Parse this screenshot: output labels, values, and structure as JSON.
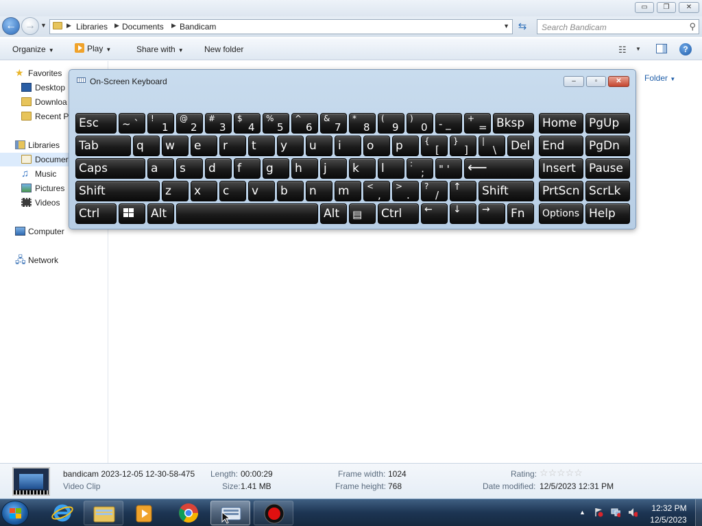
{
  "window": {
    "minimize": "▭",
    "maximize": "❐",
    "close": "✕"
  },
  "address": {
    "crumbs": [
      "Libraries",
      "Documents",
      "Bandicam"
    ],
    "search_placeholder": "Search Bandicam"
  },
  "toolbar": {
    "organize": "Organize",
    "play": "Play",
    "share_with": "Share with",
    "new_folder": "New folder"
  },
  "nav": {
    "favorites": "Favorites",
    "desktop": "Desktop",
    "downloads": "Downloa",
    "recent_places": "Recent Pl",
    "libraries": "Libraries",
    "documents": "Documer",
    "music": "Music",
    "pictures": "Pictures",
    "videos": "Videos",
    "computer": "Computer",
    "network": "Network"
  },
  "content": {
    "arrange_by": "Folder"
  },
  "osk": {
    "title": "On-Screen Keyboard",
    "keys": {
      "esc": "Esc",
      "tilde": "~ `",
      "d1_s": "!",
      "d1": "1",
      "d2_s": "@",
      "d2": "2",
      "d3_s": "#",
      "d3": "3",
      "d4_s": "$",
      "d4": "4",
      "d5_s": "%",
      "d5": "5",
      "d6_s": "^",
      "d6": "6",
      "d7_s": "&",
      "d7": "7",
      "d8_s": "*",
      "d8": "8",
      "d9_s": "(",
      "d9": "9",
      "d0_s": ")",
      "d0": "0",
      "minus": "- _",
      "plus_s": "+",
      "equals": "=",
      "bksp": "Bksp",
      "home": "Home",
      "pgup": "PgUp",
      "tab": "Tab",
      "q": "q",
      "w": "w",
      "e": "e",
      "r": "r",
      "t": "t",
      "y": "y",
      "u": "u",
      "i": "i",
      "o": "o",
      "p": "p",
      "lbr_s": "{",
      "lbr": "[",
      "rbr_s": "}",
      "rbr": "]",
      "bsl_s": "|",
      "bsl": "\\",
      "del": "Del",
      "end": "End",
      "pgdn": "PgDn",
      "caps": "Caps",
      "a": "a",
      "s": "s",
      "d": "d",
      "f": "f",
      "g": "g",
      "h": "h",
      "j": "j",
      "k": "k",
      "l": "l",
      "semi_s": ":",
      "semi": ";",
      "quote": "\" '",
      "enter": "⟵",
      "insert": "Insert",
      "pause": "Pause",
      "shift": "Shift",
      "z": "z",
      "x": "x",
      "c": "c",
      "v": "v",
      "b": "b",
      "n": "n",
      "m": "m",
      "comma_s": "<",
      "comma": ",",
      "period_s": ">",
      "period": ".",
      "slash_s": "?",
      "slash": "/",
      "up": "↑",
      "rshift": "Shift",
      "prtscn": "PrtScn",
      "scrlk": "ScrLk",
      "ctrl": "Ctrl",
      "alt": "Alt",
      "ralt": "Alt",
      "menu": "▤",
      "rctrl": "Ctrl",
      "left": "←",
      "down": "↓",
      "right": "→",
      "fn": "Fn",
      "options": "Options",
      "help": "Help"
    }
  },
  "details": {
    "filename": "bandicam 2023-12-05 12-30-58-475",
    "type": "Video Clip",
    "length_label": "Length:",
    "length": "00:00:29",
    "size_label": "Size:",
    "size": "1.41 MB",
    "fw_label": "Frame width:",
    "fw": "1024",
    "fh_label": "Frame height:",
    "fh": "768",
    "rating_label": "Rating:",
    "rating": 0,
    "modified_label": "Date modified:",
    "modified": "12/5/2023 12:31 PM"
  },
  "taskbar": {
    "time": "12:32 PM",
    "date": "12/5/2023"
  }
}
